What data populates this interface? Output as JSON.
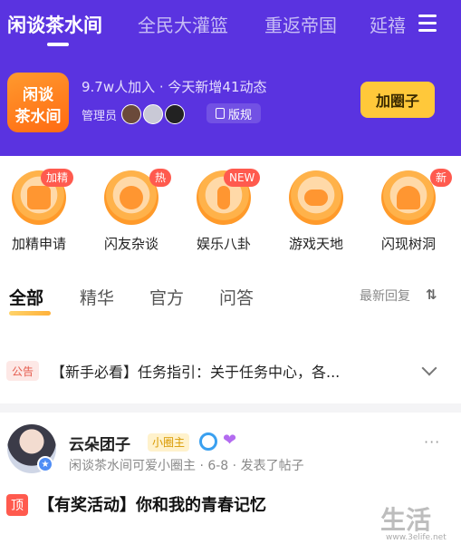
{
  "header": {
    "tabs": [
      {
        "label": "闲谈茶水间",
        "active": true
      },
      {
        "label": "全民大灌篮",
        "active": false
      },
      {
        "label": "重返帝国",
        "active": false
      },
      {
        "label": "延禧",
        "active": false
      }
    ],
    "menu_icon": "menu-icon"
  },
  "circle": {
    "logo_line1": "闲谈",
    "logo_line2": "茶水间",
    "stats": "9.7w人加入 · 今天新增41动态",
    "admin_label": "管理员",
    "rules_label": "版规",
    "join_label": "加圈子"
  },
  "categories": [
    {
      "label": "加精申请",
      "badge": "加精"
    },
    {
      "label": "闪友杂谈",
      "badge": "热"
    },
    {
      "label": "娱乐八卦",
      "badge": "NEW"
    },
    {
      "label": "游戏天地",
      "badge": ""
    },
    {
      "label": "闪现树洞",
      "badge": "新"
    }
  ],
  "section_tabs": [
    "全部",
    "精华",
    "官方",
    "问答"
  ],
  "sort_label": "最新回复",
  "notice": {
    "tag": "公告",
    "text": "【新手必看】任务指引：关于任务中心，各..."
  },
  "post": {
    "author": "云朵团子",
    "role": "小圈主",
    "meta": "闲谈茶水间可爱小圈主 · 6-8 · 发表了帖子",
    "top_tag": "顶",
    "title": "【有奖活动】你和我的青春记忆",
    "more": "···"
  },
  "watermark": {
    "main": "生活",
    "url": "www.3elife.net"
  },
  "colors": {
    "header_bg": "#5a33e0",
    "accent_yellow": "#ffc83a",
    "badge_red": "#ff5a4e"
  }
}
